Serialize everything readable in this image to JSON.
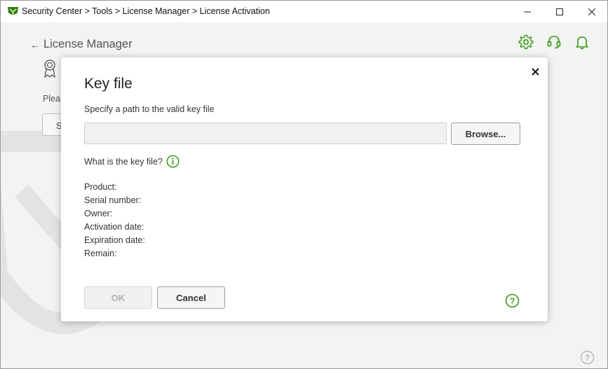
{
  "window": {
    "title": "Security Center > Tools > License Manager > License Activation",
    "controls": {
      "minimize_icon": "minimize-icon",
      "maximize_icon": "maximize-icon",
      "close_icon": "close-icon"
    }
  },
  "page": {
    "back_label": "License Manager",
    "back_icon": "arrow-left-icon",
    "header_icons": [
      "gear-icon",
      "headset-icon",
      "bell-icon"
    ],
    "certificate_icon": "certificate-icon",
    "partial_text": "Plea",
    "partial_button": "S",
    "help_icon": "question-icon"
  },
  "dialog": {
    "title": "Key file",
    "instruction": "Specify a path to the valid key file",
    "path_value": "",
    "browse_label": "Browse...",
    "what_is_label": "What is the key file?",
    "fields": {
      "product": "Product:",
      "serial_number": "Serial number:",
      "owner": "Owner:",
      "activation_date": "Activation date:",
      "expiration_date": "Expiration date:",
      "remain": "Remain:"
    },
    "ok_label": "OK",
    "ok_enabled": false,
    "cancel_label": "Cancel",
    "close_icon": "close-icon",
    "help_icon": "question-icon"
  },
  "colors": {
    "accent_green": "#3a9a17",
    "page_background": "#f3f3f3",
    "dialog_background": "#ffffff",
    "disabled_text": "#b0b0b0"
  }
}
